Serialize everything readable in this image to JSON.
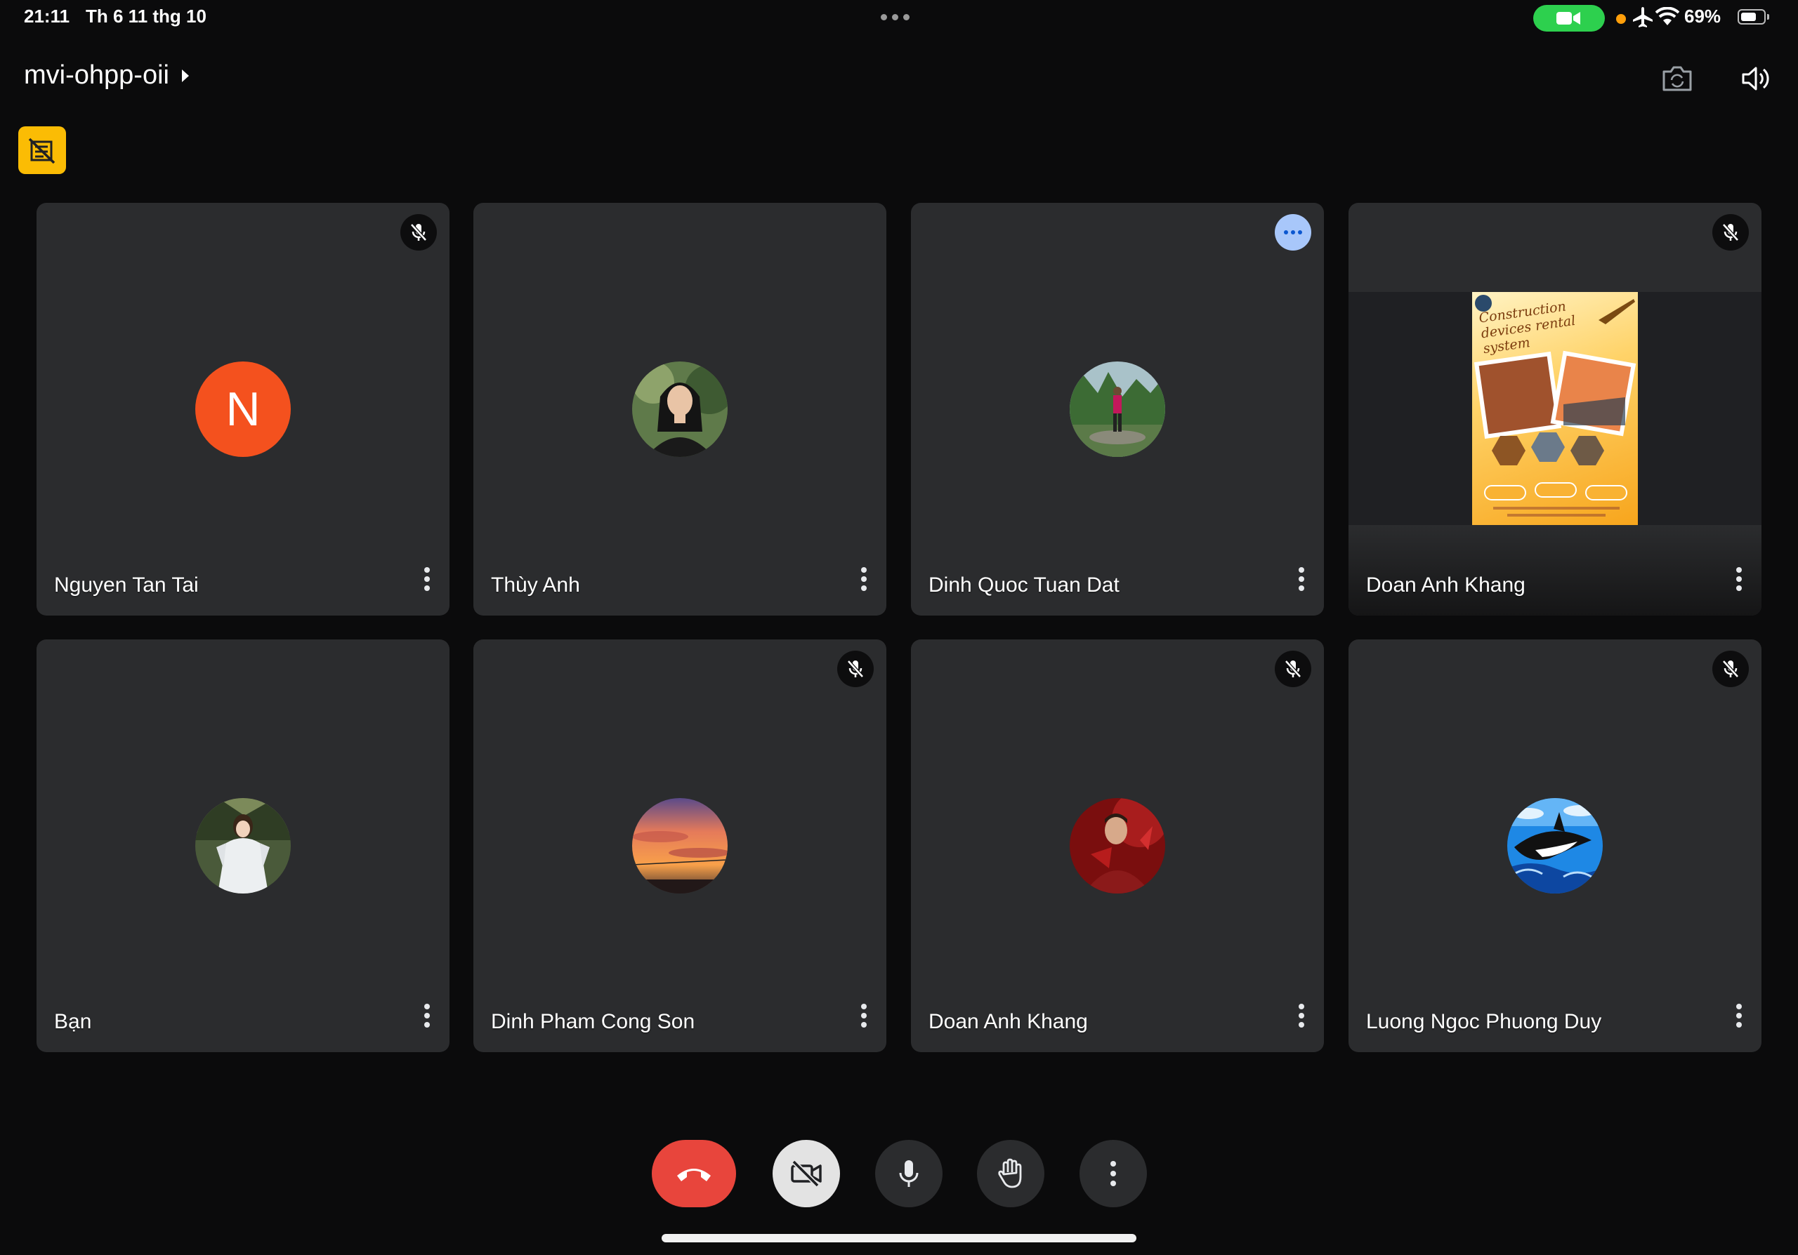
{
  "status_bar": {
    "time": "21:11",
    "date": "Th 6 11 thg 10",
    "battery_text": "69%",
    "battery_level": 0.69,
    "camera_indicator_color": "#2dd04e",
    "privacy_dot_color": "#ff9f0a",
    "icons": [
      "more-dots-icon",
      "camera-video-icon",
      "airplane-icon",
      "wifi-icon",
      "battery-icon"
    ]
  },
  "header": {
    "meeting_code": "mvi-ohpp-oii",
    "icons": [
      "chevron-right-icon",
      "switch-camera-icon",
      "speaker-icon",
      "no-image-flag-icon"
    ]
  },
  "participants": [
    {
      "name": "Nguyen Tan Tai",
      "avatar": "letter",
      "initial": "N",
      "avatar_color": "#f4511e",
      "muted": true
    },
    {
      "name": "Thùy Anh",
      "avatar": "photo",
      "muted": false
    },
    {
      "name": "Dinh Quoc Tuan Dat",
      "avatar": "photo",
      "muted": false,
      "speaking": true
    },
    {
      "name": "Doan Anh Khang",
      "avatar": "screen-share",
      "muted": true,
      "shared_content": {
        "title": "Construction devices rental system"
      }
    },
    {
      "name": "Bạn",
      "avatar": "photo",
      "muted": false
    },
    {
      "name": "Dinh Pham Cong Son",
      "avatar": "photo",
      "muted": true
    },
    {
      "name": "Doan Anh Khang",
      "avatar": "photo",
      "muted": true
    },
    {
      "name": "Luong Ngoc Phuong Duy",
      "avatar": "photo",
      "muted": true
    }
  ],
  "controls": [
    {
      "name": "end-call",
      "icon": "phone-hangup-icon",
      "color": "#e8453c"
    },
    {
      "name": "camera-off",
      "icon": "video-off-icon",
      "color": "#e3e3e3"
    },
    {
      "name": "microphone",
      "icon": "mic-icon",
      "color": "#2b2c2e"
    },
    {
      "name": "raise-hand",
      "icon": "hand-icon",
      "color": "#2b2c2e"
    },
    {
      "name": "more-options",
      "icon": "more-vert-icon",
      "color": "#2b2c2e"
    }
  ],
  "colors": {
    "background": "#0b0b0c",
    "tile": "#2b2c2e",
    "flag_button": "#fbbc04",
    "speaking_badge": "#a8c7fa"
  }
}
